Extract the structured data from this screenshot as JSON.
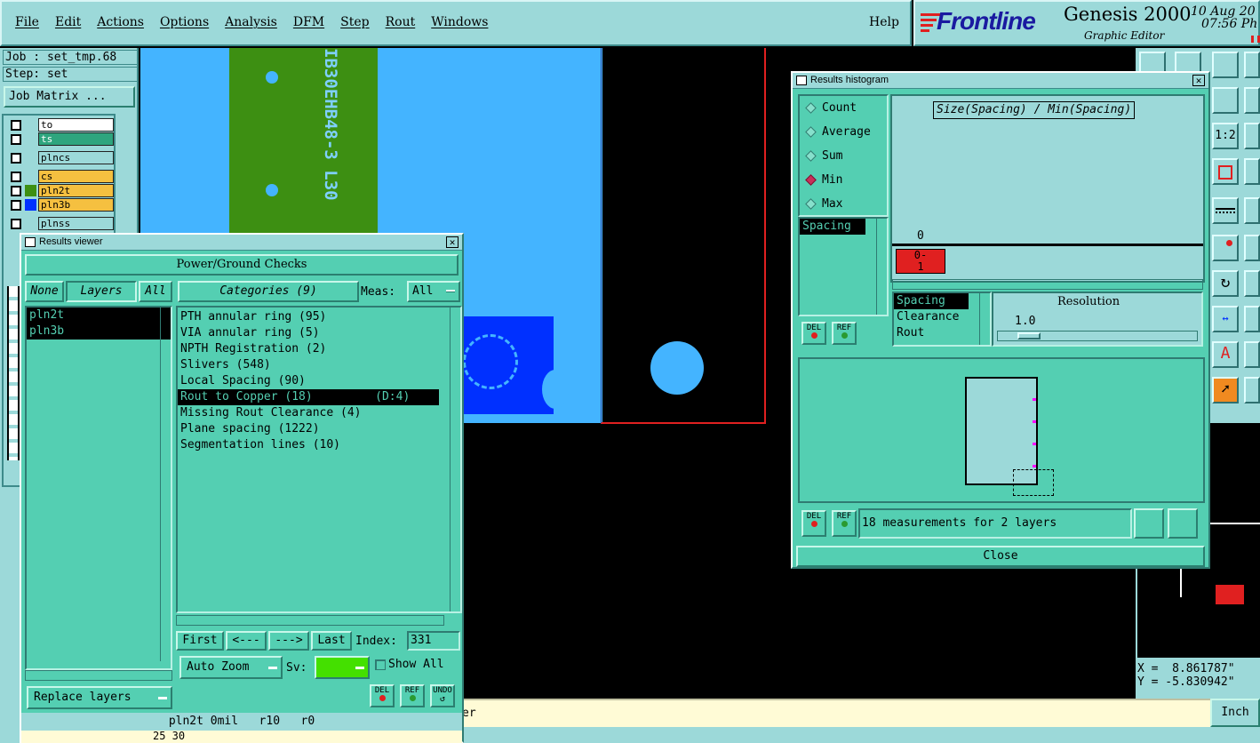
{
  "menu": {
    "items": [
      "File",
      "Edit",
      "Actions",
      "Options",
      "Analysis",
      "DFM",
      "Step",
      "Rout",
      "Windows"
    ],
    "help": "Help"
  },
  "brand": {
    "logo": "Frontline",
    "product": "Genesis 2000",
    "subtitle": "Graphic Editor",
    "date": "10 Aug 20",
    "time": "07:56 Ph"
  },
  "job": {
    "job_label": "Job : set_tmp.68",
    "step_label": "Step: set",
    "matrix_button": "Job Matrix ..."
  },
  "layers": [
    {
      "name": "to",
      "color": "#ffffff",
      "text": "#000000"
    },
    {
      "name": "ts",
      "color": "#2ea57e",
      "text": "#ffffff"
    },
    {
      "name": "plncs",
      "color": "#9cd9d9",
      "text": "#000000"
    },
    {
      "name": "cs",
      "color": "#f5c040",
      "text": "#000000"
    },
    {
      "name": "pln2t",
      "color": "#f5c040",
      "text": "#000000"
    },
    {
      "name": "pln3b",
      "color": "#f5c040",
      "text": "#000000"
    },
    {
      "name": "plnss",
      "color": "#9cd9d9",
      "text": "#000000"
    }
  ],
  "canvas": {
    "vertical_text": "IB30EHB48-3 L30",
    "colors": {
      "cyan": "#44b4ff",
      "green": "#3d8f12",
      "blue": "#0030ff",
      "red_outline": "#e02020"
    }
  },
  "results_viewer": {
    "title": "Results viewer",
    "banner": "Power/Ground Checks",
    "none_btn": "None",
    "layers_label": "Layers",
    "all_btn": "All",
    "categories_label": "Categories (9)",
    "meas_label": "Meas:",
    "meas_value": "All",
    "layer_list": [
      "pln2t",
      "pln3b"
    ],
    "categories": [
      "PTH annular ring (95)",
      "VIA annular ring (5)",
      "NPTH Registration (2)",
      "Slivers (548)",
      "Local Spacing (90)",
      "Rout to Copper (18)         (D:4)",
      "Missing Rout Clearance (4)",
      "Plane spacing (1222)",
      "Segmentation lines (10)"
    ],
    "selected_category": 5,
    "nav": {
      "first": "First",
      "prev": "<---",
      "next": "--->",
      "last": "Last",
      "index_label": "Index:",
      "index_value": "331"
    },
    "auto_zoom": "Auto Zoom",
    "sv_label": "Sv:",
    "show_all": "Show All",
    "replace_layers": "Replace layers",
    "del": "DEL",
    "ref": "REF",
    "undo": "UNDO",
    "status": "pln2t 0mil   r10   r0",
    "coords_bottom": "25 30"
  },
  "histogram": {
    "title": "Results histogram",
    "options": [
      "Count",
      "Average",
      "Sum",
      "Min",
      "Max"
    ],
    "selected_option": "Min",
    "measure_list": [
      "Spacing"
    ],
    "chart_title": "Size(Spacing) / Min(Spacing)",
    "axis_zero": "0",
    "bar_label": "0-\n1",
    "attr_list": [
      "Spacing",
      "Clearance",
      "Rout"
    ],
    "resolution_label": "Resolution",
    "resolution_value": "1.0",
    "measurements": "18 measurements for 2 layers",
    "close": "Close",
    "del": "DEL",
    "ref": "REF"
  },
  "right_tools": {
    "scale_label": "1:2",
    "coords": {
      "x": "X =  8.861787\"",
      "y": "Y = -5.830942\""
    },
    "unit": "Inch"
  },
  "statusbar": {
    "fragment": "er"
  }
}
